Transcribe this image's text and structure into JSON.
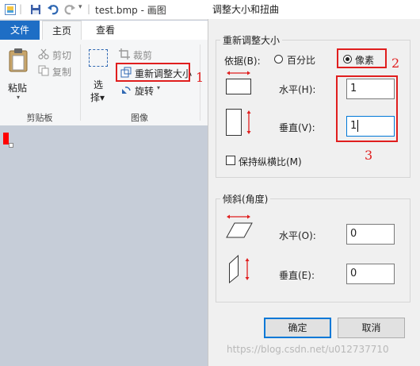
{
  "window": {
    "title": "test.bmp - 画图"
  },
  "tabs": {
    "file": "文件",
    "home": "主页",
    "view": "查看"
  },
  "clipboard": {
    "paste": "粘贴",
    "cut": "剪切",
    "copy": "复制",
    "group_label": "剪贴板"
  },
  "image_group": {
    "select": "选择",
    "crop": "裁剪",
    "resize": "重新调整大小",
    "rotate": "旋转",
    "group_label": "图像"
  },
  "dialog": {
    "title": "调整大小和扭曲",
    "resize": {
      "legend": "重新调整大小",
      "basis_label": "依据(B):",
      "percent_label": "百分比",
      "pixel_label": "像素",
      "selected": "pixel",
      "horizontal_label": "水平(H):",
      "horizontal_value": "1",
      "vertical_label": "垂直(V):",
      "vertical_value": "1",
      "keep_ratio_label": "保持纵横比(M)",
      "keep_ratio_checked": false
    },
    "skew": {
      "legend": "倾斜(角度)",
      "horizontal_label": "水平(O):",
      "horizontal_value": "0",
      "vertical_label": "垂直(E):",
      "vertical_value": "0"
    },
    "ok_label": "确定",
    "cancel_label": "取消"
  },
  "annotations": {
    "n1": "1",
    "n2": "2",
    "n3": "3",
    "color": "#e01e1e"
  },
  "watermark": "https://blog.csdn.net/u012737710",
  "colors": {
    "file_tab": "#1e6ec5",
    "canvas_bg": "#c6cdd8",
    "accent": "#0078d7"
  }
}
